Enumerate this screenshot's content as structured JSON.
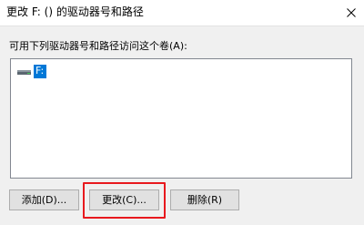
{
  "window": {
    "title": "更改 F: () 的驱动器号和路径",
    "close_icon": "close-icon"
  },
  "prompt": {
    "label": "可用下列驱动器号和路径访问这个卷(A):"
  },
  "list": {
    "items": [
      {
        "icon": "drive-icon",
        "label": "F:",
        "selected": true
      }
    ]
  },
  "buttons": {
    "add_label": "添加(D)...",
    "change_label": "更改(C)...",
    "delete_label": "删除(R)"
  },
  "colors": {
    "selection": "#0078d7",
    "highlight_box": "#e8191e",
    "dialog_bg": "#f0f0f0"
  }
}
